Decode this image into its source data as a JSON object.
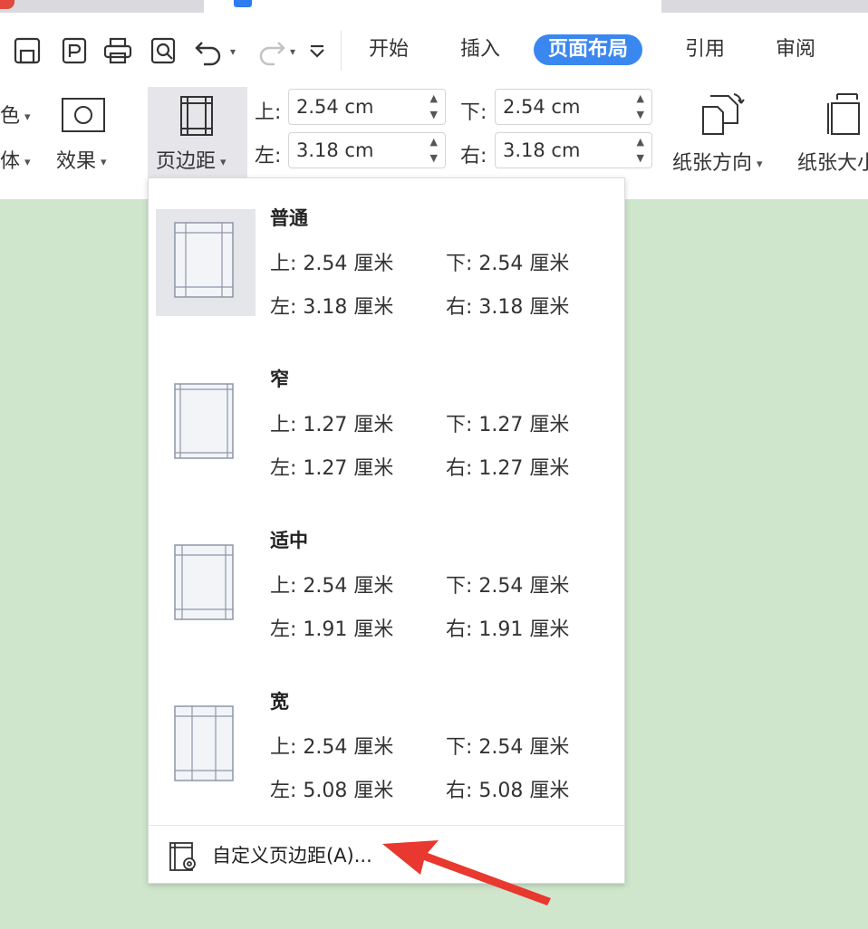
{
  "ribbon_tabs": [
    {
      "label": "开始"
    },
    {
      "label": "插入"
    },
    {
      "label": "页面布局"
    },
    {
      "label": "引用"
    },
    {
      "label": "审阅"
    }
  ],
  "ribbon": {
    "color_label": "色",
    "font_label": "体",
    "effect_label": "效果",
    "margin_button_label": "页边距",
    "orientation_label": "纸张方向",
    "size_label": "纸张大小"
  },
  "margin_fields": {
    "top_label": "上:",
    "top_value": "2.54 cm",
    "bottom_label": "下:",
    "bottom_value": "2.54 cm",
    "left_label": "左:",
    "left_value": "3.18 cm",
    "right_label": "右:",
    "right_value": "3.18 cm"
  },
  "margin_presets": [
    {
      "name": "普通",
      "top": "上: 2.54 厘米",
      "bottom": "下: 2.54 厘米",
      "left": "左: 3.18 厘米",
      "right": "右: 3.18 厘米",
      "selected": true
    },
    {
      "name": "窄",
      "top": "上: 1.27 厘米",
      "bottom": "下: 1.27 厘米",
      "left": "左: 1.27 厘米",
      "right": "右: 1.27 厘米",
      "selected": false
    },
    {
      "name": "适中",
      "top": "上: 2.54 厘米",
      "bottom": "下: 2.54 厘米",
      "left": "左: 1.91 厘米",
      "right": "右: 1.91 厘米",
      "selected": false
    },
    {
      "name": "宽",
      "top": "上: 2.54 厘米",
      "bottom": "下: 2.54 厘米",
      "left": "左: 5.08 厘米",
      "right": "右: 5.08 厘米",
      "selected": false
    }
  ],
  "custom_margin_label": "自定义页边距(A)...",
  "colors": {
    "accent": "#3b87f0",
    "document_background": "#cfe6cc",
    "annotation_arrow": "#e8382f"
  },
  "icons": [
    "save-icon",
    "export-pdf-icon",
    "print-icon",
    "print-preview-icon",
    "undo-icon",
    "redo-icon",
    "customize-toolbar-icon",
    "page-border-icon",
    "effect-icon",
    "margin-icon",
    "orientation-icon",
    "paper-size-icon",
    "custom-margin-icon"
  ]
}
